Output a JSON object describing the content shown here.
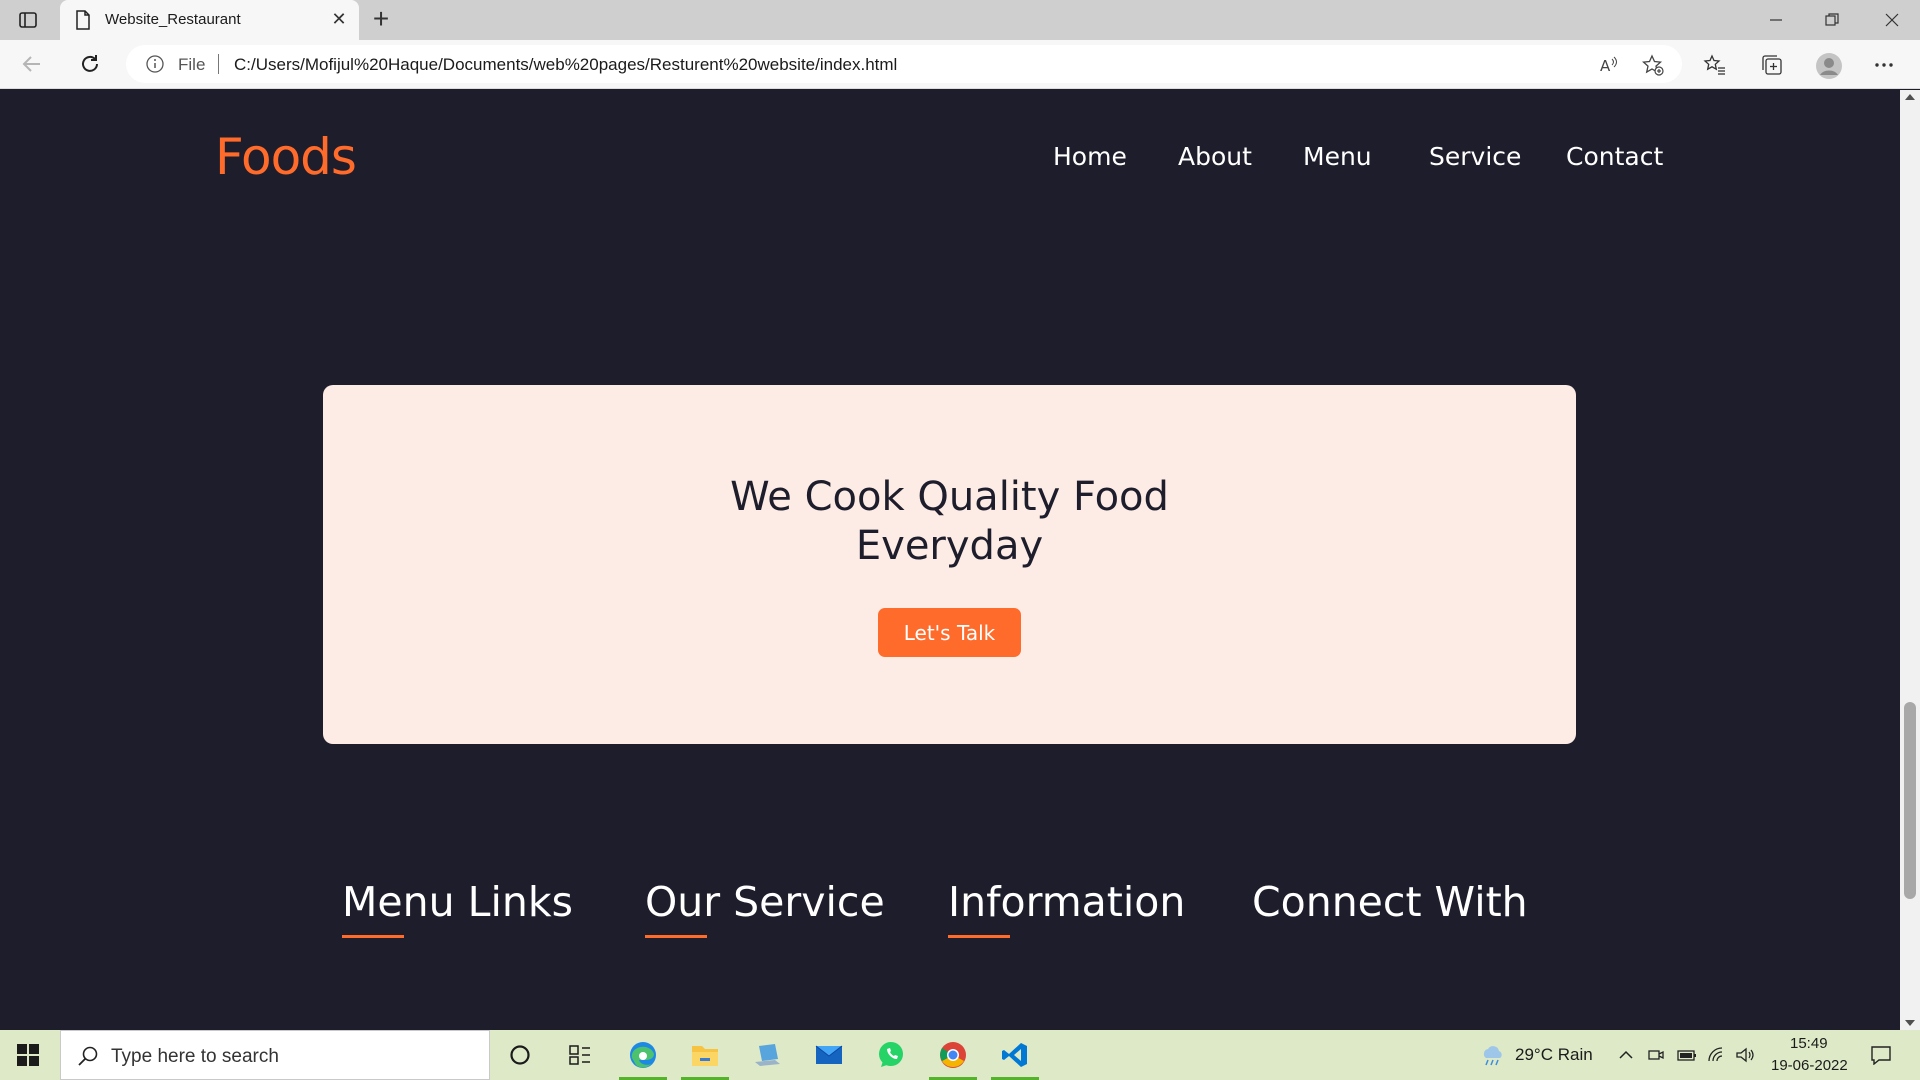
{
  "browser": {
    "tab_title": "Website_Restaurant",
    "file_label": "File",
    "url": "C:/Users/Mofijul%20Haque/Documents/web%20pages/Resturent%20website/index.html"
  },
  "site": {
    "logo": "Foods",
    "nav": [
      "Home",
      "About",
      "Menu",
      "Service",
      "Contact"
    ]
  },
  "cta": {
    "title_line1": "We Cook Quality Food",
    "title_line2": "Everyday",
    "button": "Let's Talk"
  },
  "footer": {
    "headings": [
      "Menu Links",
      "Our Service",
      "Information",
      "Connect With"
    ]
  },
  "taskbar": {
    "search_placeholder": "Type here to search",
    "weather": "29°C  Rain",
    "time": "15:49",
    "date": "19-06-2022"
  },
  "colors": {
    "accent": "#ff6b2b",
    "page_bg": "#1e1d2b",
    "card_bg": "#fdebe6"
  }
}
